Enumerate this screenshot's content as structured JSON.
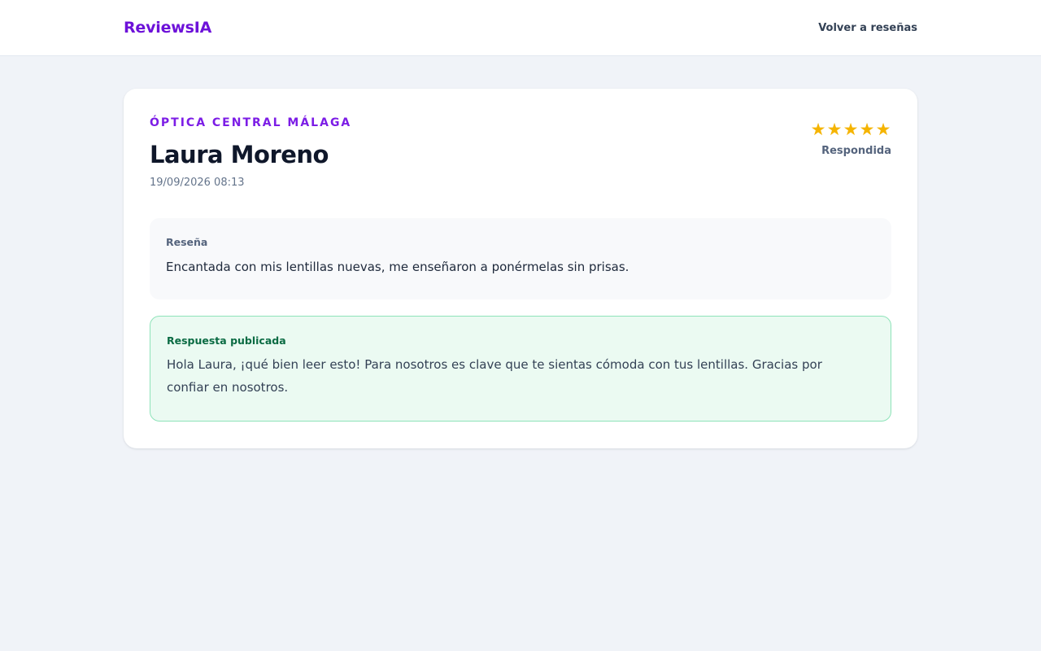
{
  "header": {
    "logo": "ReviewsIA",
    "back_link": "Volver a reseñas"
  },
  "review": {
    "business_name": "ÓPTICA CENTRAL MÁLAGA",
    "author": "Laura Moreno",
    "date": "19/09/2026 08:13",
    "rating": 5,
    "rating_max": 5,
    "stars": [
      "★",
      "★",
      "★",
      "★",
      "★"
    ],
    "status": "Respondida",
    "review_label": "Reseña",
    "review_text": "Encantada con mis lentillas nuevas, me enseñaron a ponérmelas sin prisas.",
    "response_label": "Respuesta publicada",
    "response_text": "Hola Laura, ¡qué bien leer esto! Para nosotros es clave que te sientas cómoda con tus lentillas. Gracias por confiar en nosotros."
  },
  "colors": {
    "brand": "#6d11d9",
    "star": "#f5b400",
    "response_bg": "#ebfaf2",
    "response_border": "#8ee3b9",
    "response_label": "#0a6b43"
  }
}
